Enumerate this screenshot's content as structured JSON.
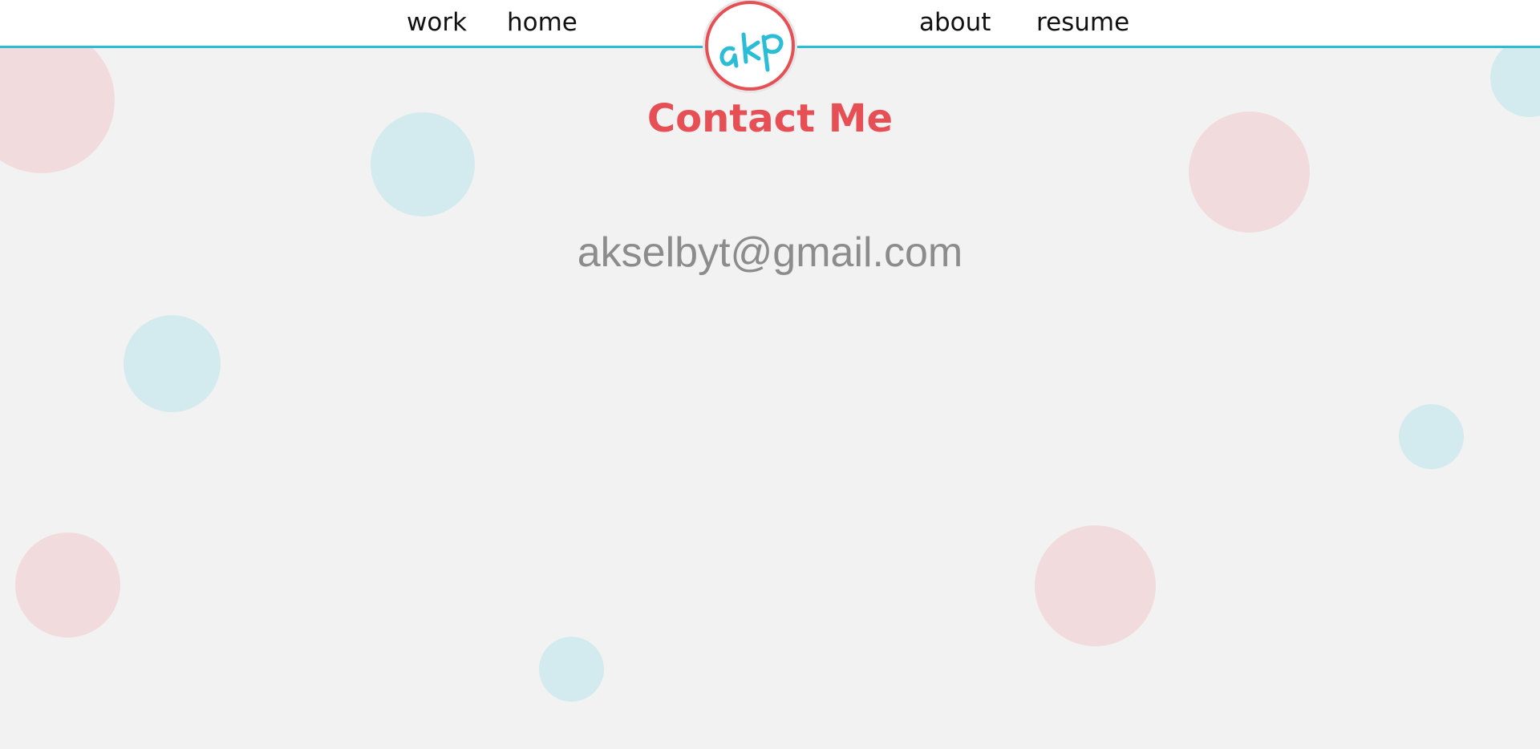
{
  "nav": {
    "links": [
      "work",
      "home",
      "about",
      "resume"
    ]
  },
  "logo": {
    "text": "akp",
    "icon": "akp-logo-icon"
  },
  "main": {
    "title": "Contact Me",
    "email": "akselbyt@gmail.com"
  },
  "colors": {
    "accent_red": "#e65055",
    "accent_cyan": "#2bbcd6",
    "background": "#f2f2f2",
    "bubble_pink": "#f2dbdd",
    "bubble_blue": "#d3ebee",
    "email_text": "#8c8c8c"
  }
}
